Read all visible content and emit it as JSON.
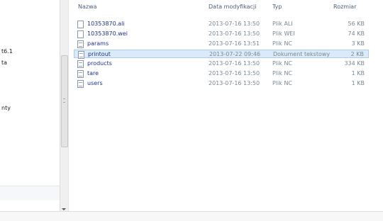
{
  "header": {
    "name": "Nazwa",
    "modified": "Data modyfikacji",
    "type": "Typ",
    "size": "Rozmiar"
  },
  "nav": {
    "items": [
      "",
      "t6.1",
      "ta",
      "nty"
    ]
  },
  "files": [
    {
      "name": "10353870.ali",
      "date": "2013-07-16 13:50",
      "type": "Plik ALI",
      "size": "56 KB",
      "icon": "file-icon",
      "selected": false
    },
    {
      "name": "10353870.wei",
      "date": "2013-07-16 13:50",
      "type": "Plik WEI",
      "size": "74 KB",
      "icon": "file-icon",
      "selected": false
    },
    {
      "name": "params",
      "date": "2013-07-16 13:51",
      "type": "Plik NC",
      "size": "3 KB",
      "icon": "file-icon",
      "selected": false
    },
    {
      "name": "printout",
      "date": "2013-07-22 09:46",
      "type": "Dokument tekstowy",
      "size": "2 KB",
      "icon": "text-document-icon",
      "selected": true
    },
    {
      "name": "products",
      "date": "2013-07-16 13:50",
      "type": "Plik NC",
      "size": "334 KB",
      "icon": "file-icon",
      "selected": false
    },
    {
      "name": "tare",
      "date": "2013-07-16 13:50",
      "type": "Plik NC",
      "size": "1 KB",
      "icon": "file-icon",
      "selected": false
    },
    {
      "name": "users",
      "date": "2013-07-16 13:50",
      "type": "Plik NC",
      "size": "1 KB",
      "icon": "file-icon",
      "selected": false
    }
  ]
}
